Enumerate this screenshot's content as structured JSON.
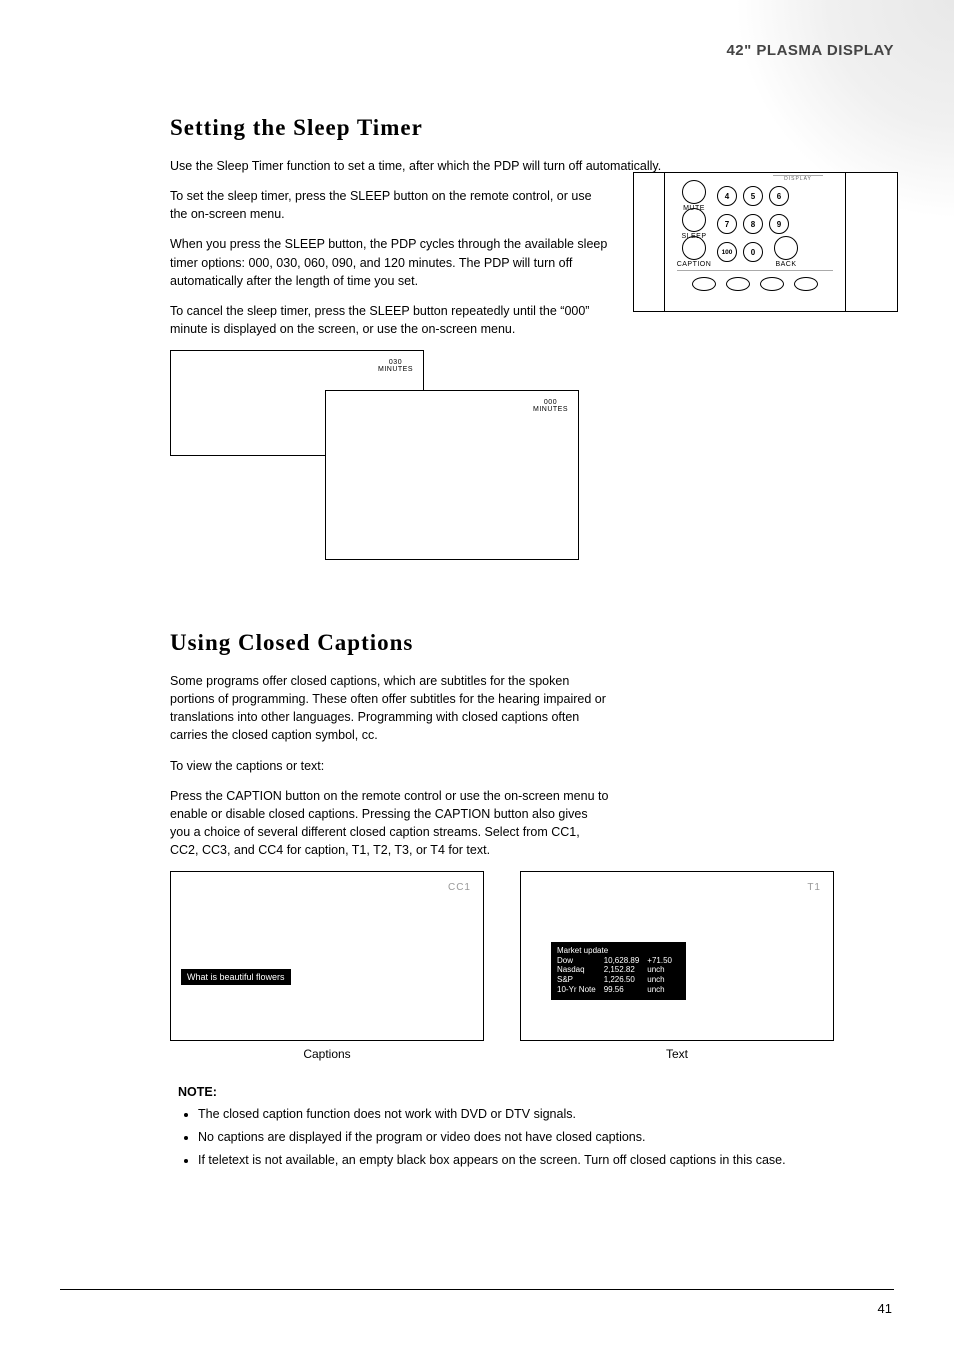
{
  "header": "42\" PLASMA DISPLAY",
  "sleep": {
    "title": "Setting  the  Sleep Timer",
    "p1": "Use the Sleep Timer function to set a time, after which the PDP will turn off automatically.",
    "p2": "To set the sleep timer, press the SLEEP button on the remote control, or use the on-screen menu.",
    "p3": "When you press the SLEEP button, the PDP cycles through the available sleep timer options: 000, 030, 060, 090, and 120 minutes. The PDP will turn off automatically after the length of time you set.",
    "p4": "To cancel the sleep timer, press the SLEEP button repeatedly until the “000” minute is displayed on the screen, or use the on-screen menu.",
    "osdA_line1": "030",
    "osdA_line2": "MINUTES",
    "osdB_line1": "000",
    "osdB_line2": "MINUTES"
  },
  "remote": {
    "top": "DISPLAY",
    "mute": "MUTE",
    "sleep": "SLEEP",
    "caption": "CAPTION",
    "back": "BACK",
    "k4": "4",
    "k5": "5",
    "k6": "6",
    "k7": "7",
    "k8": "8",
    "k9": "9",
    "k100": "100",
    "k0": "0"
  },
  "cc": {
    "title": "Using  Closed  Captions",
    "p1": "Some programs offer closed captions, which are subtitles for the spoken portions of programming. These often offer subtitles for the hearing impaired or translations into other languages. Programming with closed captions often carries the closed caption symbol, cc.",
    "p2": "To view the captions or text:",
    "p3": "Press the CAPTION button on the remote control or use the on-screen menu to enable or disable closed captions. Pressing the CAPTION button also gives you a choice of several different closed caption streams. Select from CC1, CC2, CC3, and CC4 for caption, T1, T2, T3, or T4 for text.",
    "fig_caption_left": "Captions",
    "fig_caption_right": "Text",
    "mode_cc": "CC1",
    "mode_t": "T1",
    "subtitle": "What is beautiful flowers"
  },
  "chart_data": {
    "type": "table",
    "title": "Market update",
    "series": [
      {
        "name": "Dow",
        "values": [
          "10,628.89",
          "+71.50"
        ]
      },
      {
        "name": "Nasdaq",
        "values": [
          "2,152.82",
          "unch"
        ]
      },
      {
        "name": "S&P",
        "values": [
          "1,226.50",
          "unch"
        ]
      },
      {
        "name": "10-Yr Note",
        "values": [
          "99.56",
          "unch"
        ]
      }
    ]
  },
  "note": {
    "label": "NOTE:",
    "n1": "The closed caption function does not work with DVD or DTV signals.",
    "n2": "No captions are displayed if the program or video does not have closed captions.",
    "n3": "If teletext is not available, an empty black box appears on the screen. Turn off closed captions in this case."
  },
  "page": "41"
}
